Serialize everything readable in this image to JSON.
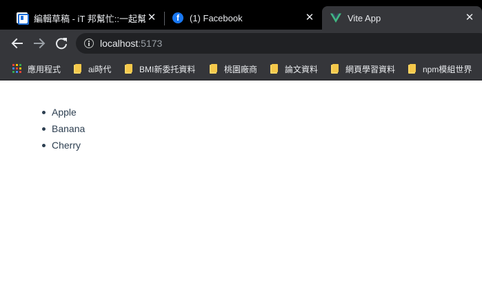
{
  "tabs": [
    {
      "title": "編輯草稿 - iT 邦幫忙::一起幫忙",
      "favicon": "ithome-icon",
      "active": false
    },
    {
      "title": "(1) Facebook",
      "favicon": "facebook-icon",
      "active": false
    },
    {
      "title": "Vite App",
      "favicon": "vue-icon",
      "active": true
    }
  ],
  "tab_close_glyph": "✕",
  "address": {
    "host": "localhost",
    "port": ":5173"
  },
  "bookmarks": [
    {
      "label": "應用程式",
      "icon": "apps-grid-icon"
    },
    {
      "label": "ai時代",
      "icon": "folder-icon"
    },
    {
      "label": "BMI新委托資料",
      "icon": "folder-icon"
    },
    {
      "label": "桃園廠商",
      "icon": "folder-icon"
    },
    {
      "label": "論文資料",
      "icon": "folder-icon"
    },
    {
      "label": "網頁學習資料",
      "icon": "folder-icon"
    },
    {
      "label": "npm模組世界",
      "icon": "folder-icon"
    }
  ],
  "list": {
    "items": [
      "Apple",
      "Banana",
      "Cherry"
    ]
  },
  "colors": {
    "vue_green": "#41b883",
    "vue_dark": "#35495e",
    "text": "#2c3e50",
    "chrome_dark": "#35363a"
  }
}
